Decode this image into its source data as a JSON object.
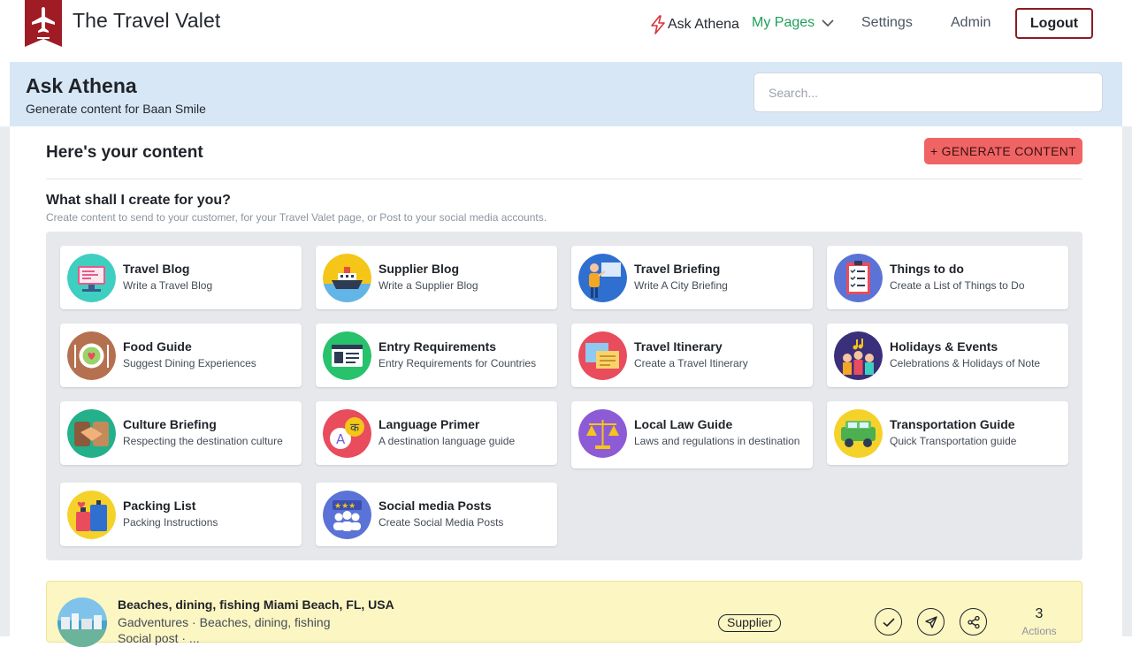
{
  "brand": {
    "name": "The Travel Valet",
    "color": "#a01c24"
  },
  "nav": {
    "ask_label": "Ask Athena",
    "mypages_label": "My Pages",
    "settings_label": "Settings",
    "admin_label": "Admin",
    "logout_label": "Logout"
  },
  "header": {
    "title": "Ask Athena",
    "subtitle": "Generate content for Baan Smile",
    "search_placeholder": "Search..."
  },
  "content": {
    "title": "Here's your content",
    "generate_label": "+ GENERATE CONTENT",
    "question": "What shall I create for you?",
    "question_sub": "Create content to send to your customer, for your Travel Valet page, or Post to your social media accounts."
  },
  "cards": [
    {
      "title": "Travel Blog",
      "desc": "Write a Travel Blog",
      "icon": "computer-icon"
    },
    {
      "title": "Supplier Blog",
      "desc": "Write a Supplier Blog",
      "icon": "ship-icon"
    },
    {
      "title": "Travel Briefing",
      "desc": "Write A City Briefing",
      "icon": "presenter-icon"
    },
    {
      "title": "Things to do",
      "desc": "Create a List of Things to Do",
      "icon": "checklist-icon"
    },
    {
      "title": "Food Guide",
      "desc": "Suggest Dining Experiences",
      "icon": "dining-icon"
    },
    {
      "title": "Entry Requirements",
      "desc": "Entry Requirements for Countries",
      "icon": "passport-icon"
    },
    {
      "title": "Travel Itinerary",
      "desc": "Create a Travel Itinerary",
      "icon": "itinerary-icon"
    },
    {
      "title": "Holidays & Events",
      "desc": "Celebrations & Holidays of Note",
      "icon": "celebration-icon"
    },
    {
      "title": "Culture Briefing",
      "desc": "Respecting the destination culture",
      "icon": "handshake-icon"
    },
    {
      "title": "Language Primer",
      "desc": "A destination language guide",
      "icon": "translate-icon"
    },
    {
      "title": "Local Law Guide",
      "desc": "Laws and regulations in destination",
      "icon": "scales-icon"
    },
    {
      "title": "Transportation Guide",
      "desc": "Quick Transportation guide",
      "icon": "vehicle-icon"
    },
    {
      "title": "Packing List",
      "desc": "Packing Instructions",
      "icon": "luggage-icon"
    },
    {
      "title": "Social media Posts",
      "desc": "Create Social Media Posts",
      "icon": "social-icon"
    }
  ],
  "item": {
    "title": "Beaches, dining, fishing Miami Beach, FL, USA",
    "subtitle": "Gadventures · Beaches, dining, fishing",
    "subtitle2": "Social post · ...",
    "badge": "Supplier",
    "actions_count": "3",
    "actions_label": "Actions"
  }
}
